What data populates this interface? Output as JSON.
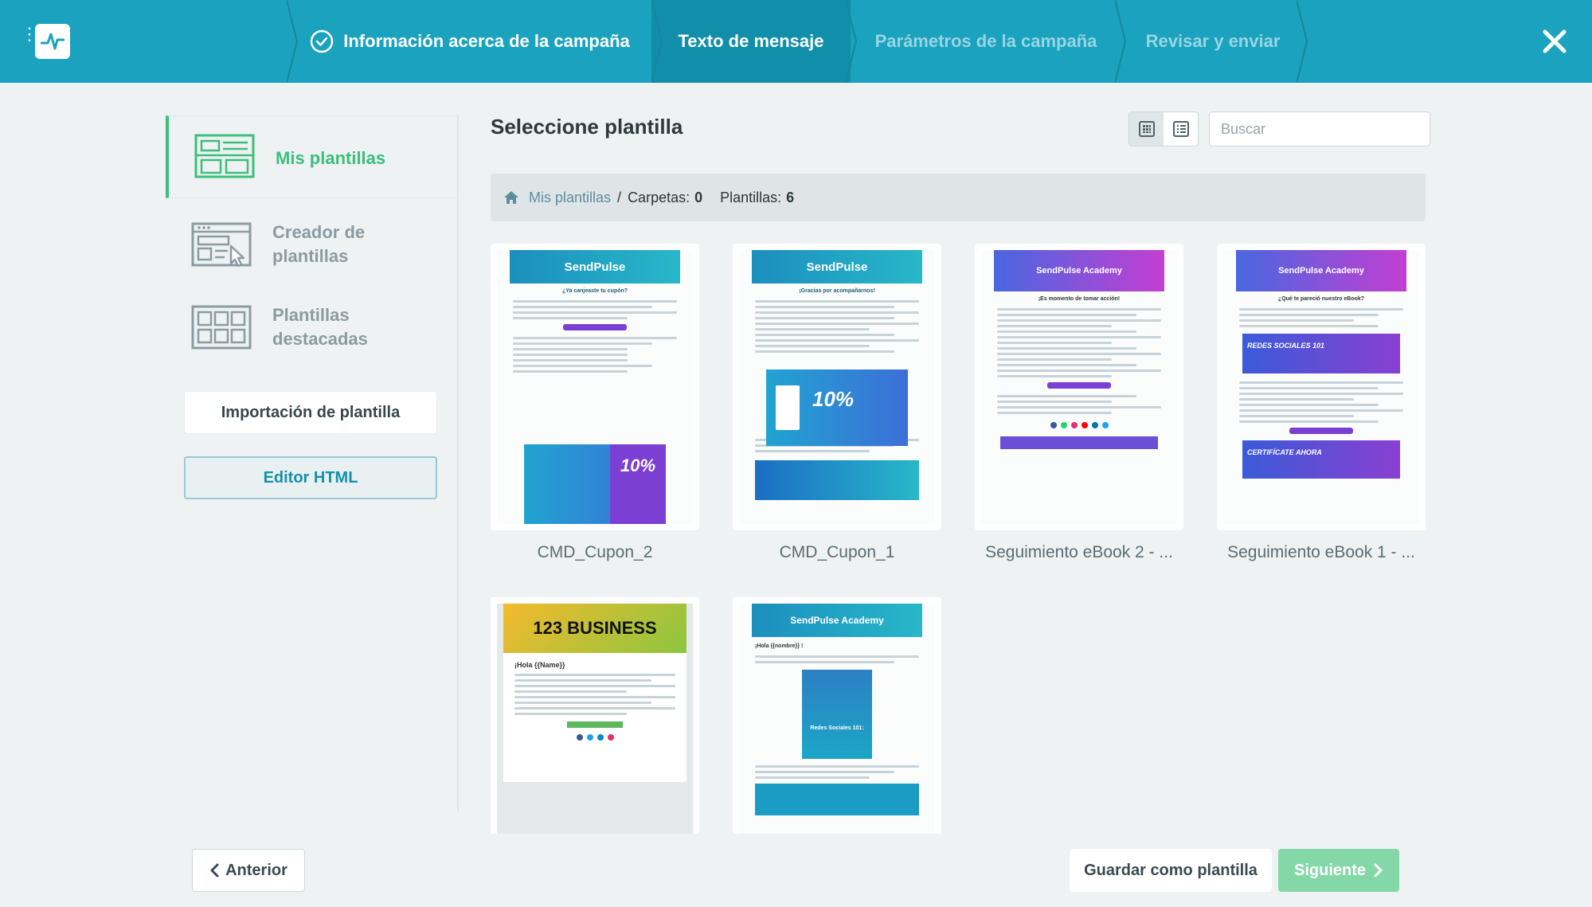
{
  "header": {
    "steps": [
      {
        "label": "Información acerca de la campaña",
        "state": "done"
      },
      {
        "label": "Texto de mensaje",
        "state": "active"
      },
      {
        "label": "Parámetros de la campaña",
        "state": "todo"
      },
      {
        "label": "Revisar y enviar",
        "state": "todo"
      }
    ]
  },
  "sidebar": {
    "items": [
      {
        "label": "Mis plantillas",
        "icon": "my-templates-icon"
      },
      {
        "label": "Creador de plantillas",
        "icon": "template-builder-icon"
      },
      {
        "label": "Plantillas destacadas",
        "icon": "featured-templates-icon"
      }
    ],
    "import_label": "Importación de plantilla",
    "html_editor_label": "Editor HTML"
  },
  "main": {
    "title": "Seleccione plantilla",
    "search_placeholder": "Buscar",
    "breadcrumb": {
      "link": "Mis plantillas",
      "separator": "/",
      "folders_label": "Carpetas:",
      "folders_count": "0",
      "templates_label": "Plantillas:",
      "templates_count": "6"
    },
    "templates": [
      {
        "name": "CMD_Cupon_2",
        "thumb_header": "SendPulse",
        "thumb_heading": "¿Ya canjeaste tu cupón?",
        "promo": "10%"
      },
      {
        "name": "CMD_Cupon_1",
        "thumb_header": "SendPulse",
        "thumb_heading": "¡Gracias por acompañarnos!",
        "promo": "10%"
      },
      {
        "name": "Seguimiento eBook 2 - ...",
        "thumb_header": "SendPulse Academy",
        "thumb_heading": "¡Es momento de tomar acción!"
      },
      {
        "name": "Seguimiento eBook 1 - ...",
        "thumb_header": "SendPulse Academy",
        "thumb_heading": "¿Qué te pareció nuestro eBook?",
        "banner1": "REDES SOCIALES 101",
        "banner2": "CERTIFÍCATE AHORA"
      },
      {
        "name": "",
        "thumb_header": "123 BUSINESS",
        "thumb_heading": "¡Hola {{Name}}"
      },
      {
        "name": "",
        "thumb_header": "SendPulse Academy",
        "thumb_heading": "¡Hola {{nombre}} !",
        "banner1": "Redes Sociales 101:"
      }
    ]
  },
  "footer": {
    "prev_label": "Anterior",
    "save_label": "Guardar como plantilla",
    "next_label": "Siguiente"
  },
  "colors": {
    "brand": "#1aa2be",
    "accent_green": "#3bbf7b",
    "next_button": "#84d8a8"
  }
}
